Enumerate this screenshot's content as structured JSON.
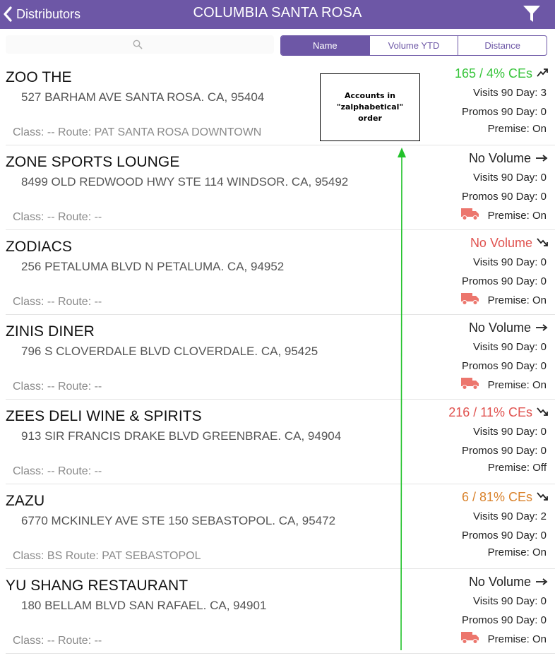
{
  "navbar": {
    "back_label": "Distributors",
    "title": "COLUMBIA SANTA ROSA",
    "back_icon": "chevron-left-icon",
    "filter_icon": "funnel-icon"
  },
  "search": {
    "placeholder": "",
    "icon": "search-icon"
  },
  "sort_tabs": [
    {
      "label": "Name",
      "active": true
    },
    {
      "label": "Volume YTD",
      "active": false
    },
    {
      "label": "Distance",
      "active": false
    }
  ],
  "colors": {
    "brand": "#6d57a6",
    "green": "#36c43a",
    "red": "#e0524f",
    "orange": "#d9822b",
    "truck": "#ec766d",
    "annotation_arrow": "#22c22b"
  },
  "accounts": [
    {
      "name": "ZOO THE",
      "address": "527 BARHAM AVE SANTA ROSA. CA, 95404",
      "class_route": "Class: --  Route: PAT SANTA ROSA DOWNTOWN",
      "volume": "165 / 4% CEs",
      "volume_color": "#36c43a",
      "trend_icon": "trend-up-icon",
      "visits": "Visits 90 Day: 3",
      "promos": "Promos 90 Day: 0",
      "premise": "Premise: On",
      "truck": false
    },
    {
      "name": "ZONE SPORTS LOUNGE",
      "address": "8499 OLD REDWOOD HWY STE 114 WINDSOR. CA, 95492",
      "class_route": "Class: --  Route: --",
      "volume": "No Volume",
      "volume_color": "#222222",
      "trend_icon": "trend-flat-icon",
      "visits": "Visits 90 Day: 0",
      "promos": "Promos 90 Day: 0",
      "premise": "Premise: On",
      "truck": true
    },
    {
      "name": "ZODIACS",
      "address": "256 PETALUMA BLVD N PETALUMA. CA, 94952",
      "class_route": "Class: --  Route: --",
      "volume": "No Volume",
      "volume_color": "#e0524f",
      "trend_icon": "trend-down-icon",
      "visits": "Visits 90 Day: 0",
      "promos": "Promos 90 Day: 0",
      "premise": "Premise: On",
      "truck": true
    },
    {
      "name": "ZINIS DINER",
      "address": "796 S CLOVERDALE BLVD CLOVERDALE. CA, 95425",
      "class_route": "Class: --  Route: --",
      "volume": "No Volume",
      "volume_color": "#222222",
      "trend_icon": "trend-flat-icon",
      "visits": "Visits 90 Day: 0",
      "promos": "Promos 90 Day: 0",
      "premise": "Premise: On",
      "truck": true
    },
    {
      "name": "ZEES DELI WINE & SPIRITS",
      "address": "913 SIR FRANCIS DRAKE BLVD GREENBRAE. CA, 94904",
      "class_route": "Class: --  Route: --",
      "volume": "216 / 11% CEs",
      "volume_color": "#e0524f",
      "trend_icon": "trend-down-icon",
      "visits": "Visits 90 Day: 0",
      "promos": "Promos 90 Day: 0",
      "premise": "Premise: Off",
      "truck": false
    },
    {
      "name": "ZAZU",
      "address": "6770 MCKINLEY AVE STE 150 SEBASTOPOL. CA, 95472",
      "class_route": "Class: BS  Route: PAT SEBASTOPOL",
      "volume": "6 / 81% CEs",
      "volume_color": "#d9822b",
      "trend_icon": "trend-down-icon",
      "visits": "Visits 90 Day: 2",
      "promos": "Promos 90 Day: 0",
      "premise": "Premise: On",
      "truck": false
    },
    {
      "name": "YU SHANG RESTAURANT",
      "address": "180 BELLAM BLVD SAN RAFAEL. CA, 94901",
      "class_route": "Class: --  Route: --",
      "volume": "No Volume",
      "volume_color": "#222222",
      "trend_icon": "trend-flat-icon",
      "visits": "Visits 90 Day: 0",
      "promos": "Promos 90 Day: 0",
      "premise": "Premise: On",
      "truck": true
    }
  ],
  "annotation": {
    "text": "Accounts in \"zalphabetical\" order"
  }
}
